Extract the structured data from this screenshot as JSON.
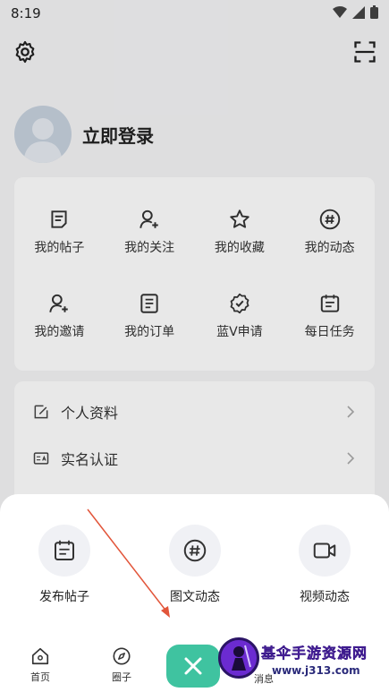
{
  "status_bar": {
    "time": "8:19"
  },
  "profile": {
    "login_label": "立即登录"
  },
  "grid_items": [
    {
      "label": "我的帖子",
      "icon": "post-icon"
    },
    {
      "label": "我的关注",
      "icon": "follow-user-icon"
    },
    {
      "label": "我的收藏",
      "icon": "star-icon"
    },
    {
      "label": "我的动态",
      "icon": "hashtag-icon"
    },
    {
      "label": "我的邀请",
      "icon": "invite-user-icon"
    },
    {
      "label": "我的订单",
      "icon": "order-icon"
    },
    {
      "label": "蓝V申请",
      "icon": "verified-badge-icon"
    },
    {
      "label": "每日任务",
      "icon": "calendar-task-icon"
    }
  ],
  "list_items": [
    {
      "label": "个人资料",
      "icon": "edit-profile-icon"
    },
    {
      "label": "实名认证",
      "icon": "id-card-icon"
    }
  ],
  "sheet": {
    "actions": [
      {
        "label": "发布帖子",
        "icon": "post-calendar-icon"
      },
      {
        "label": "图文动态",
        "icon": "hashtag-icon"
      },
      {
        "label": "视频动态",
        "icon": "video-icon"
      }
    ]
  },
  "tabbar": {
    "tabs": [
      {
        "label": "首页",
        "icon": "home-icon"
      },
      {
        "label": "圈子",
        "icon": "compass-icon"
      },
      {
        "label": "消息",
        "icon": "message-icon"
      }
    ]
  },
  "watermark": {
    "title": "基伞手游资源网",
    "url": "www.j313.com"
  },
  "colors": {
    "accent": "#3fc3a0",
    "arrow": "#e2553a"
  }
}
